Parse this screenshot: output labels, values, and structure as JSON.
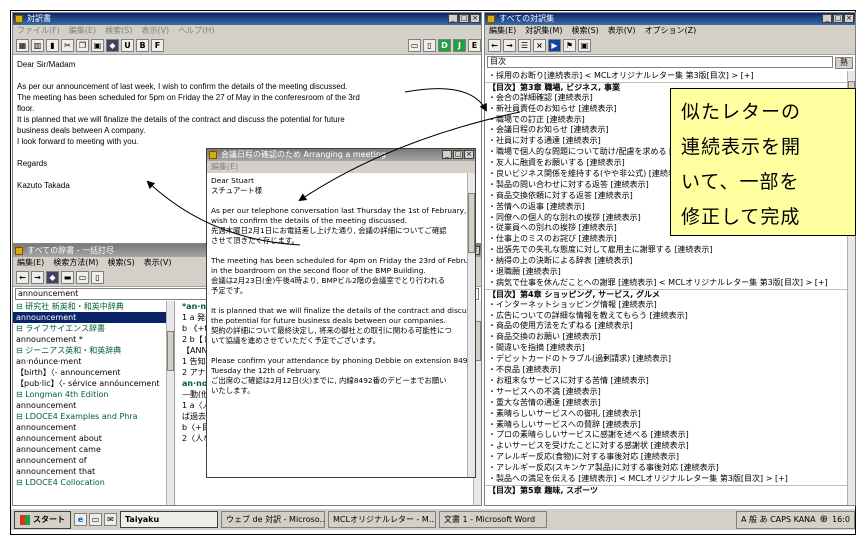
{
  "word_window": {
    "title": "対訳書",
    "menu": [
      "ファイル(F)",
      "編集(E)",
      "検索(S)",
      "表示(V)",
      "ヘルプ(H)"
    ],
    "doc_lines": [
      "Dear Sir/Madam",
      "",
      "As per our announcement of last week, I wish to confirm the details of the meeting discussed.",
      "The meeting has been scheduled for 5pm on Friday the 27 of May in the conferesroom of the 3rd",
      "floor.",
      "It is planned that we will finalize the details of the contract and discuss the potential for future",
      "business deals between A company.",
      "I look forward to meeting with you.",
      "",
      "Regards",
      "",
      "Kazuto Takada"
    ]
  },
  "dict_window": {
    "title": "すべての辞書 - 一括打尽",
    "menu": [
      "編集(E)",
      "検索方法(M)",
      "検索(S)",
      "表示(V)"
    ],
    "search_value": "announcement",
    "entries": [
      {
        "text": "⊟ 研究社 新英和・和英中辞典",
        "kind": "head"
      },
      {
        "text": "announcement",
        "kind": "sel"
      },
      {
        "text": "⊟ ライフサイエンス辞書",
        "kind": "head"
      },
      {
        "text": "announcement *",
        "kind": "item"
      },
      {
        "text": "⊟ ジーニアス英和・和英辞典",
        "kind": "head"
      },
      {
        "text": "an·nóunce·ment",
        "kind": "item"
      },
      {
        "text": "【birth】〈-  announcement",
        "kind": "item"
      },
      {
        "text": "【pub·lic】〈-  sérvice annóuncement",
        "kind": "item"
      },
      {
        "text": "⊟ Longman 4th Edition",
        "kind": "head"
      },
      {
        "text": "announcement",
        "kind": "item"
      },
      {
        "text": "⊟ LDOCE4 Examples and Phra",
        "kind": "head"
      },
      {
        "text": "announcement",
        "kind": "item"
      },
      {
        "text": "announcement about",
        "kind": "item"
      },
      {
        "text": "announcement came",
        "kind": "item"
      },
      {
        "text": "announcement of",
        "kind": "item"
      },
      {
        "text": "announcement that",
        "kind": "item"
      },
      {
        "text": "⊟ LDOCE4 Collocation",
        "kind": "head"
      }
    ],
    "definition_lines": [
      "*an·nounce",
      "1 a 発表, 告",
      "b 《+that》",
      "2 b【トランプ】",
      "【ANNOUN",
      "1 告知者, 通",
      "2 アナウンサー, 放送員",
      "an·noy /ənɔ́i/ —◀",
      "—動(他)",
      "1 a〈人などを〉いやな(ことで)うるさがらせる, いらだたせる, 怒らせる, 悩ます (★しばし",
      "ば過去分詞で形容詞的に用いる; ⇒—annoyed 2;【類語】⇒—bother)→",
      "b〈+目+前+(代)名〉〈人などを〉いやなことで困らせる, 怒らせる, 悩ます (by, with)→",
      "2〈人などを〉しつこく悩ます→"
    ]
  },
  "letter_window": {
    "title": "会議日程の確認のため    Arranging a meeting",
    "menu": [
      "編集(E)"
    ],
    "lines": [
      "Dear Stuart",
      "スチュアート様",
      "",
      "As per our telephone conversation last Thursday the 1st of February, I",
      "wish to confirm the details of the meeting discussed.",
      "先週木曜日2月1日にお電話差し上げた通り, 会議の詳細についてご確認",
      "させて頂きたく存じます。",
      "",
      "The meeting has been scheduled for 4pm on Friday the 23rd of February",
      "in the boardroom on the second floor of the BMP Building.",
      "会議は2月23日(金)午後4時より, BMPビル2階の会議室でとり行われる",
      "予定です。",
      "",
      "It is planned that we will finalize the details of the contract and discuss",
      "the potential for future business deals between our companies.",
      "契約の詳細について最終決定し, 将来の御社との取引に関わる可能性につ",
      "いて協議を進めさせていただく予定でございます。",
      "",
      "Please confirm your attendance by phoning Debbie on extension 8492 by",
      "Tuesday the 12th of February.",
      "ご出席のご確認は2月12日(火)までに, 内線8492番のデビーまでお願い",
      "いたします。"
    ]
  },
  "letters_window": {
    "title": "すべての対訳集",
    "menu": [
      "編集(E)",
      "対訳集(M)",
      "検索(S)",
      "表示(V)",
      "オプション(Z)"
    ],
    "search_value": "目次",
    "right_label": "熟",
    "rows": [
      {
        "t": "・採用のお断り[連続表示] < MCLオリジナルレター集 第3版[目次] > [+]",
        "k": "mix"
      },
      {
        "t": "【目次】第3章 職場, ビジネス, 事業",
        "k": "chapter"
      },
      {
        "t": "・会合の詳細確認 [連続表示]",
        "k": "item"
      },
      {
        "t": "・新社員責任のお知らせ [連続表示]",
        "k": "item"
      },
      {
        "t": "・職場での訂正 [連続表示]",
        "k": "item"
      },
      {
        "t": "・会議日程のお知らせ [連続表示]",
        "k": "item"
      },
      {
        "t": "・社員に対する通達 [連続表示]",
        "k": "item"
      },
      {
        "t": "・職場で個人的な問題について助け/配慮を求める [連続表示]",
        "k": "item"
      },
      {
        "t": "・友人に融資をお願いする [連続表示]",
        "k": "item"
      },
      {
        "t": "・良いビジネス関係を維持する(やや非公式) [連続表示]",
        "k": "item"
      },
      {
        "t": "・製品の問い合わせに対する返答 [連続表示]",
        "k": "item"
      },
      {
        "t": "・商品交換依頼に対する返答 [連続表示]",
        "k": "item"
      },
      {
        "t": "・苦情への返事 [連続表示]",
        "k": "item"
      },
      {
        "t": "・同僚への個人的な別れの挨拶 [連続表示]",
        "k": "item"
      },
      {
        "t": "・従業員への別れの挨拶 [連続表示]",
        "k": "item"
      },
      {
        "t": "・仕事上のミスのお詫び [連続表示]",
        "k": "item"
      },
      {
        "t": "・出張先での失礼な態度に対して雇用主に謝罪する [連続表示]",
        "k": "item"
      },
      {
        "t": "・納得の上の決断による辞表 [連続表示]",
        "k": "item"
      },
      {
        "t": "・退職願 [連続表示]",
        "k": "item"
      },
      {
        "t": "・病気で仕事を休んだことへの謝罪 [連続表示] < MCLオリジナルレター集 第3版[目次] > [+]",
        "k": "mix"
      },
      {
        "t": "【目次】第4章 ショッピング, サービス, グルメ",
        "k": "chapter"
      },
      {
        "t": "・インターネットショッピング情報 [連続表示]",
        "k": "item"
      },
      {
        "t": "・広告についての詳細な情報を教えてもらう [連続表示]",
        "k": "item"
      },
      {
        "t": "・商品の使用方法をたずねる [連続表示]",
        "k": "item"
      },
      {
        "t": "・商品交換のお願い [連続表示]",
        "k": "item"
      },
      {
        "t": "・間違いを指摘 [連続表示]",
        "k": "item"
      },
      {
        "t": "・デビットカードのトラブル(過剰請求) [連続表示]",
        "k": "item"
      },
      {
        "t": "・不良品 [連続表示]",
        "k": "item"
      },
      {
        "t": "・お粗末なサービスに対する苦情 [連続表示]",
        "k": "item"
      },
      {
        "t": "・サービスへの不満 [連続表示]",
        "k": "item"
      },
      {
        "t": "・重大な苦情の通達 [連続表示]",
        "k": "item"
      },
      {
        "t": "・素晴らしいサービスへの御礼 [連続表示]",
        "k": "item"
      },
      {
        "t": "・素晴らしいサービスへの賛辞 [連続表示]",
        "k": "item"
      },
      {
        "t": "・プロの素晴らしいサービスに感謝を述べる [連続表示]",
        "k": "item"
      },
      {
        "t": "・よいサービスを受けたことに対する感謝状 [連続表示]",
        "k": "item"
      },
      {
        "t": "・アレルギー反応(食物)に対する事後対応 [連続表示]",
        "k": "item"
      },
      {
        "t": "・アレルギー反応(スキンケア製品)に対する事後対応 [連続表示]",
        "k": "item"
      },
      {
        "t": "・製品への満足を伝える [連続表示] < MCLオリジナルレター集 第3版[目次] > [+]",
        "k": "mix"
      },
      {
        "t": "【目次】第5章 趣味, スポーツ",
        "k": "chapter"
      }
    ]
  },
  "callout": {
    "lines": [
      "似たレターの",
      "連続表示を開",
      "いて、一部を",
      "修正して完成"
    ]
  },
  "taskbar": {
    "start_label": "スタート",
    "tasks": [
      {
        "label": "Taiyaku",
        "active": true
      },
      {
        "label": "ウェブ de 対訳 - Microso...",
        "active": false
      },
      {
        "label": "MCLオリジナルレター - M...",
        "active": false
      },
      {
        "label": "文書 1 - Microsoft Word",
        "active": false
      }
    ],
    "tray_text": "A 般 あ CAPS KANA",
    "clock": "16:0"
  },
  "colors": {
    "title_active": "#0a246a",
    "link": "#0000d0",
    "highlight": "#d00000",
    "callout_bg": "#ffffa0"
  }
}
